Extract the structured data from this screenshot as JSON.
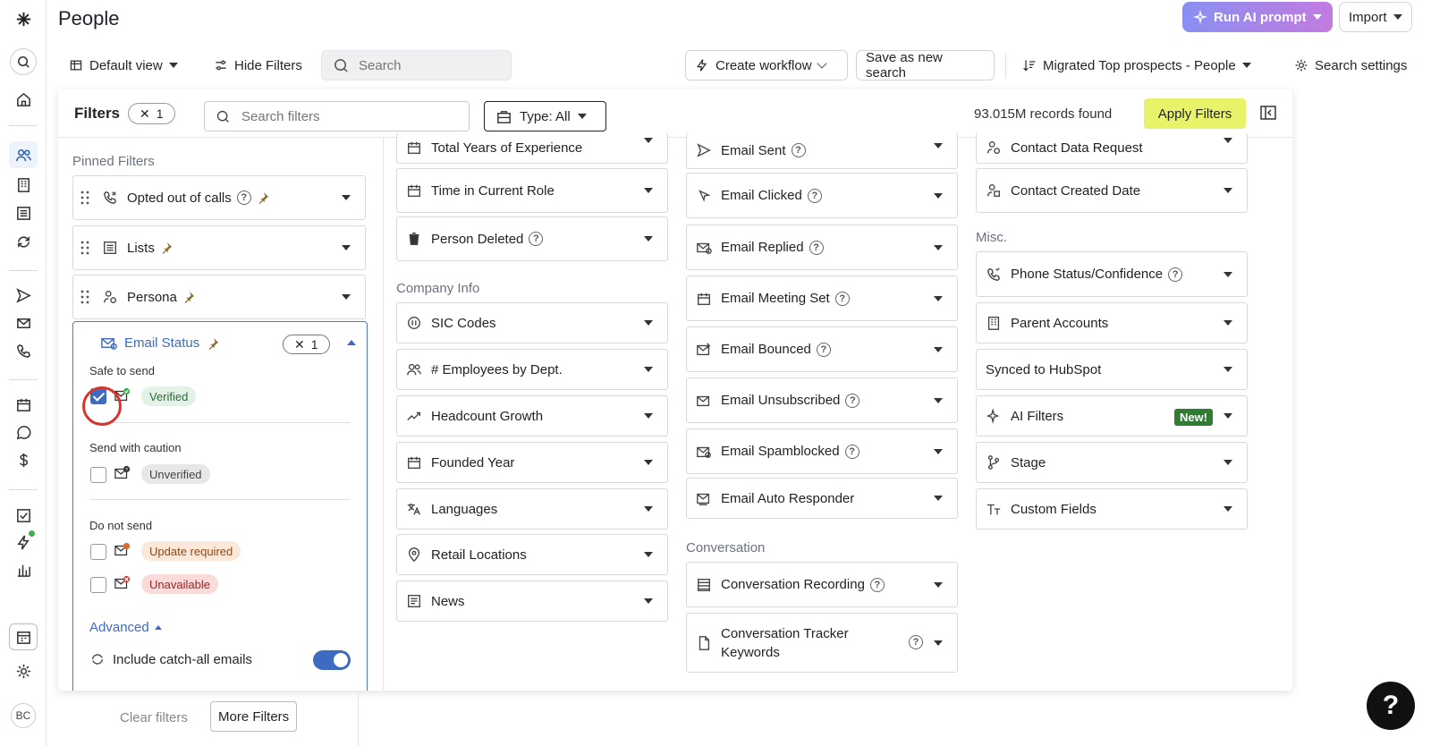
{
  "app": {
    "title": "People",
    "user_initials": "BC"
  },
  "header": {
    "run_ai_label": "Run AI prompt",
    "import_label": "Import",
    "default_view_label": "Default view",
    "hide_filters_label": "Hide Filters",
    "search_placeholder": "Search",
    "create_workflow_label": "Create workflow",
    "save_search_label": "Save as new search",
    "saved_search_label": "Migrated Top prospects - People",
    "search_settings_label": "Search settings"
  },
  "filters_panel": {
    "title": "Filters",
    "count": "1",
    "search_placeholder": "Search filters",
    "type_label": "Type: All",
    "records_found": "93.015M records found",
    "apply_label": "Apply Filters"
  },
  "pinned": {
    "title": "Pinned Filters",
    "items": [
      {
        "label": "Opted out of calls",
        "icon": "phone-off-icon"
      },
      {
        "label": "Lists",
        "icon": "list-icon"
      },
      {
        "label": "Persona",
        "icon": "persona-icon"
      }
    ]
  },
  "email_status": {
    "label": "Email Status",
    "count": "1",
    "groups": [
      {
        "title": "Safe to send",
        "options": [
          {
            "label": "Verified",
            "checked": true
          }
        ]
      },
      {
        "title": "Send with caution",
        "options": [
          {
            "label": "Unverified",
            "checked": false
          }
        ]
      },
      {
        "title": "Do not send",
        "options": [
          {
            "label": "Update required",
            "checked": false
          },
          {
            "label": "Unavailable",
            "checked": false
          }
        ]
      }
    ],
    "advanced_label": "Advanced",
    "catch_all_label": "Include catch-all emails",
    "catch_all_on": true
  },
  "column1": {
    "items_top": [
      "Total Years of Experience",
      "Time in Current Role",
      "Person Deleted"
    ],
    "company_title": "Company Info",
    "company_items": [
      "SIC Codes",
      "# Employees by Dept.",
      "Headcount Growth",
      "Founded Year",
      "Languages",
      "Retail Locations",
      "News"
    ]
  },
  "column2": {
    "items_top": [
      "Email Sent",
      "Email Clicked",
      "Email Replied",
      "Email Meeting Set",
      "Email Bounced",
      "Email Unsubscribed",
      "Email Spamblocked",
      "Email Auto Responder"
    ],
    "conversation_title": "Conversation",
    "conversation_items": [
      "Conversation Recording",
      "Conversation Tracker Keywords"
    ]
  },
  "column3": {
    "items_top": [
      "Contact Data Request",
      "Contact Created Date"
    ],
    "misc_title": "Misc.",
    "misc_items": [
      "Phone Status/Confidence",
      "Parent Accounts",
      "Synced to HubSpot",
      "AI Filters",
      "Stage",
      "Custom Fields"
    ],
    "new_badge": "New!"
  },
  "footer": {
    "clear_label": "Clear filters",
    "more_label": "More Filters",
    "help_label": "?"
  },
  "colors": {
    "accent": "#3d6bc2",
    "apply": "#e9f36a",
    "ai_gradient_start": "#8a8ff2",
    "ai_gradient_end": "#c37be0"
  }
}
